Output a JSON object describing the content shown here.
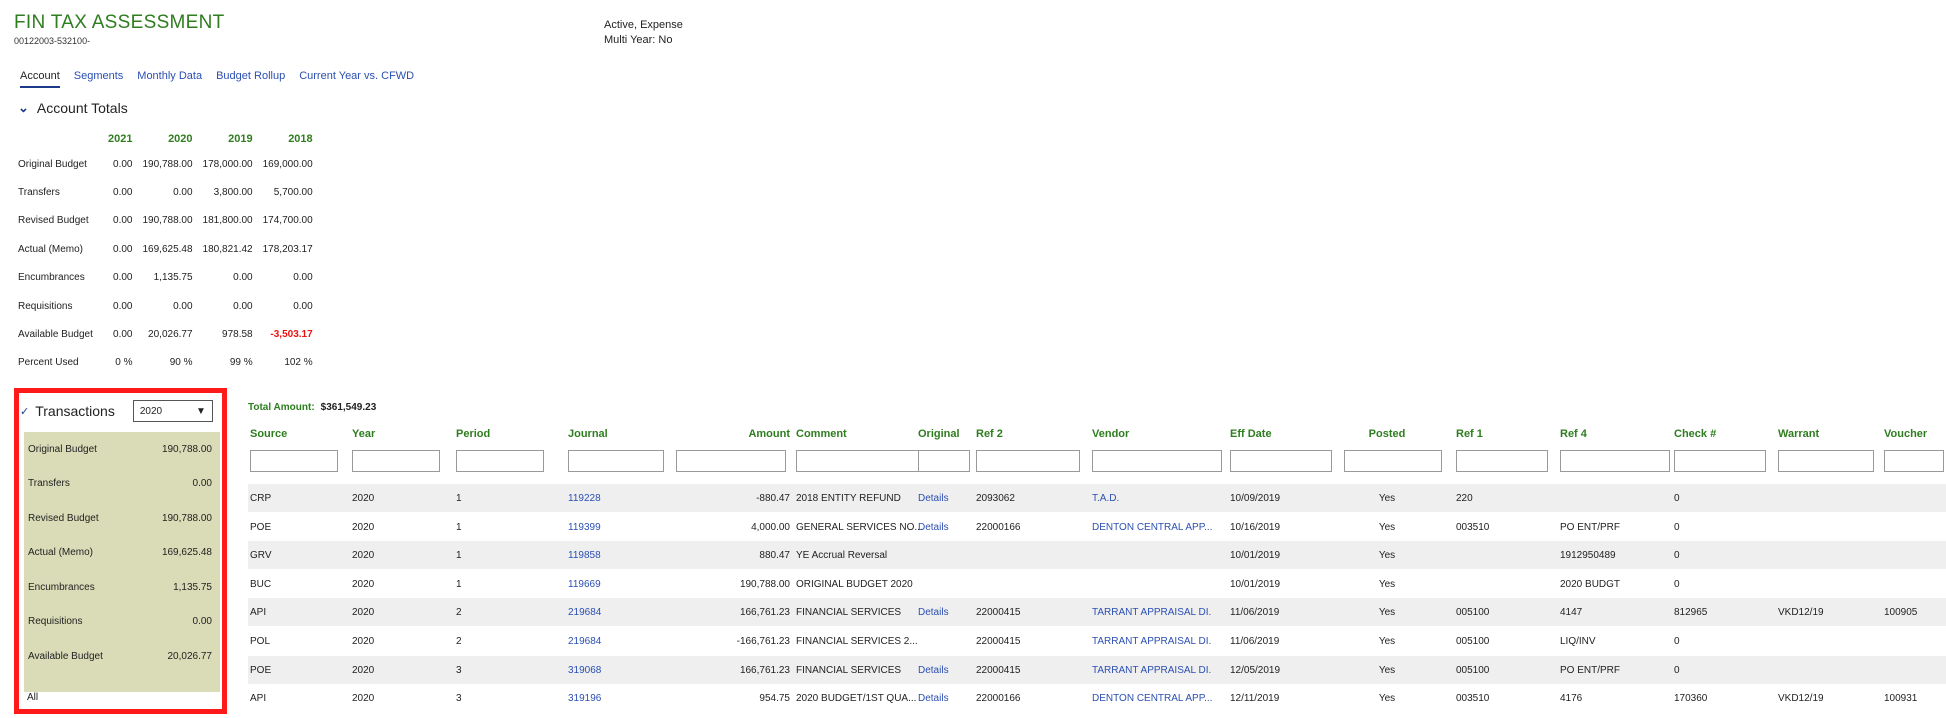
{
  "header": {
    "title": "FIN TAX ASSESSMENT",
    "account_code": "00122003-532100-",
    "status_line1": "Active, Expense",
    "status_line2": "Multi Year: No"
  },
  "tabs": [
    {
      "label": "Account",
      "active": true
    },
    {
      "label": "Segments",
      "active": false
    },
    {
      "label": "Monthly Data",
      "active": false
    },
    {
      "label": "Budget Rollup",
      "active": false
    },
    {
      "label": "Current Year vs. CFWD",
      "active": false
    }
  ],
  "account_totals": {
    "heading": "Account Totals",
    "years": [
      "2021",
      "2020",
      "2019",
      "2018"
    ],
    "rows": [
      {
        "label": "Original Budget",
        "values": [
          "0.00",
          "190,788.00",
          "178,000.00",
          "169,000.00"
        ]
      },
      {
        "label": "Transfers",
        "values": [
          "0.00",
          "0.00",
          "3,800.00",
          "5,700.00"
        ]
      },
      {
        "label": "Revised Budget",
        "values": [
          "0.00",
          "190,788.00",
          "181,800.00",
          "174,700.00"
        ]
      },
      {
        "label": "Actual (Memo)",
        "values": [
          "0.00",
          "169,625.48",
          "180,821.42",
          "178,203.17"
        ]
      },
      {
        "label": "Encumbrances",
        "values": [
          "0.00",
          "1,135.75",
          "0.00",
          "0.00"
        ]
      },
      {
        "label": "Requisitions",
        "values": [
          "0.00",
          "0.00",
          "0.00",
          "0.00"
        ]
      },
      {
        "label": "Available Budget",
        "values": [
          "0.00",
          "20,026.77",
          "978.58",
          "-3,503.17"
        ]
      },
      {
        "label": "Percent Used",
        "values": [
          "0 %",
          "90 %",
          "99 %",
          "102 %"
        ]
      }
    ]
  },
  "transactions": {
    "heading": "Transactions",
    "selected_year": "2020",
    "summary": [
      {
        "label": "Original Budget",
        "value": "190,788.00"
      },
      {
        "label": "Transfers",
        "value": "0.00"
      },
      {
        "label": "Revised Budget",
        "value": "190,788.00"
      },
      {
        "label": "Actual (Memo)",
        "value": "169,625.48"
      },
      {
        "label": "Encumbrances",
        "value": "1,135.75"
      },
      {
        "label": "Requisitions",
        "value": "0.00"
      },
      {
        "label": "Available Budget",
        "value": "20,026.77"
      }
    ],
    "all_label": "All",
    "total_amount_label": "Total Amount:",
    "total_amount_value": "$361,549.23",
    "columns": [
      "Source",
      "Year",
      "Period",
      "Journal",
      "Amount",
      "Comment",
      "Original",
      "Ref 2",
      "Vendor",
      "Eff Date",
      "Posted",
      "Ref 1",
      "Ref 4",
      "Check #",
      "Warrant",
      "Voucher"
    ],
    "rows": [
      [
        "CRP",
        "2020",
        "1",
        "119228",
        "-880.47",
        "2018 ENTITY REFUND",
        "Details",
        "2093062",
        "T.A.D.",
        "10/09/2019",
        "Yes",
        "220",
        "",
        "0",
        "",
        ""
      ],
      [
        "POE",
        "2020",
        "1",
        "119399",
        "4,000.00",
        "GENERAL SERVICES NO...",
        "Details",
        "22000166",
        "DENTON CENTRAL APP...",
        "10/16/2019",
        "Yes",
        "003510",
        "PO ENT/PRF",
        "0",
        "",
        ""
      ],
      [
        "GRV",
        "2020",
        "1",
        "119858",
        "880.47",
        "YE Accrual Reversal",
        "",
        "",
        "",
        "10/01/2019",
        "Yes",
        "",
        "1912950489",
        "0",
        "",
        ""
      ],
      [
        "BUC",
        "2020",
        "1",
        "119669",
        "190,788.00",
        "ORIGINAL BUDGET 2020",
        "",
        "",
        "",
        "10/01/2019",
        "Yes",
        "",
        "2020 BUDGT",
        "0",
        "",
        ""
      ],
      [
        "API",
        "2020",
        "2",
        "219684",
        "166,761.23",
        "FINANCIAL SERVICES",
        "Details",
        "22000415",
        "TARRANT APPRAISAL DI...",
        "11/06/2019",
        "Yes",
        "005100",
        "4147",
        "812965",
        "VKD12/19",
        "100905"
      ],
      [
        "POL",
        "2020",
        "2",
        "219684",
        "-166,761.23",
        "FINANCIAL SERVICES 2...",
        "",
        "22000415",
        "TARRANT APPRAISAL DI...",
        "11/06/2019",
        "Yes",
        "005100",
        "LIQ/INV",
        "0",
        "",
        ""
      ],
      [
        "POE",
        "2020",
        "3",
        "319068",
        "166,761.23",
        "FINANCIAL SERVICES",
        "Details",
        "22000415",
        "TARRANT APPRAISAL DI...",
        "12/05/2019",
        "Yes",
        "005100",
        "PO ENT/PRF",
        "0",
        "",
        ""
      ],
      [
        "API",
        "2020",
        "3",
        "319196",
        "954.75",
        "2020 BUDGET/1ST QUA...",
        "Details",
        "22000166",
        "DENTON CENTRAL APP...",
        "12/11/2019",
        "Yes",
        "003510",
        "4176",
        "170360",
        "VKD12/19",
        "100931"
      ]
    ]
  },
  "colors": {
    "title_green": "#2e7d1f",
    "link_blue": "#2b4fb3",
    "panel_bg": "#d9dcb7",
    "highlight_red": "#ff1a1a",
    "negative_red": "#e11111"
  }
}
